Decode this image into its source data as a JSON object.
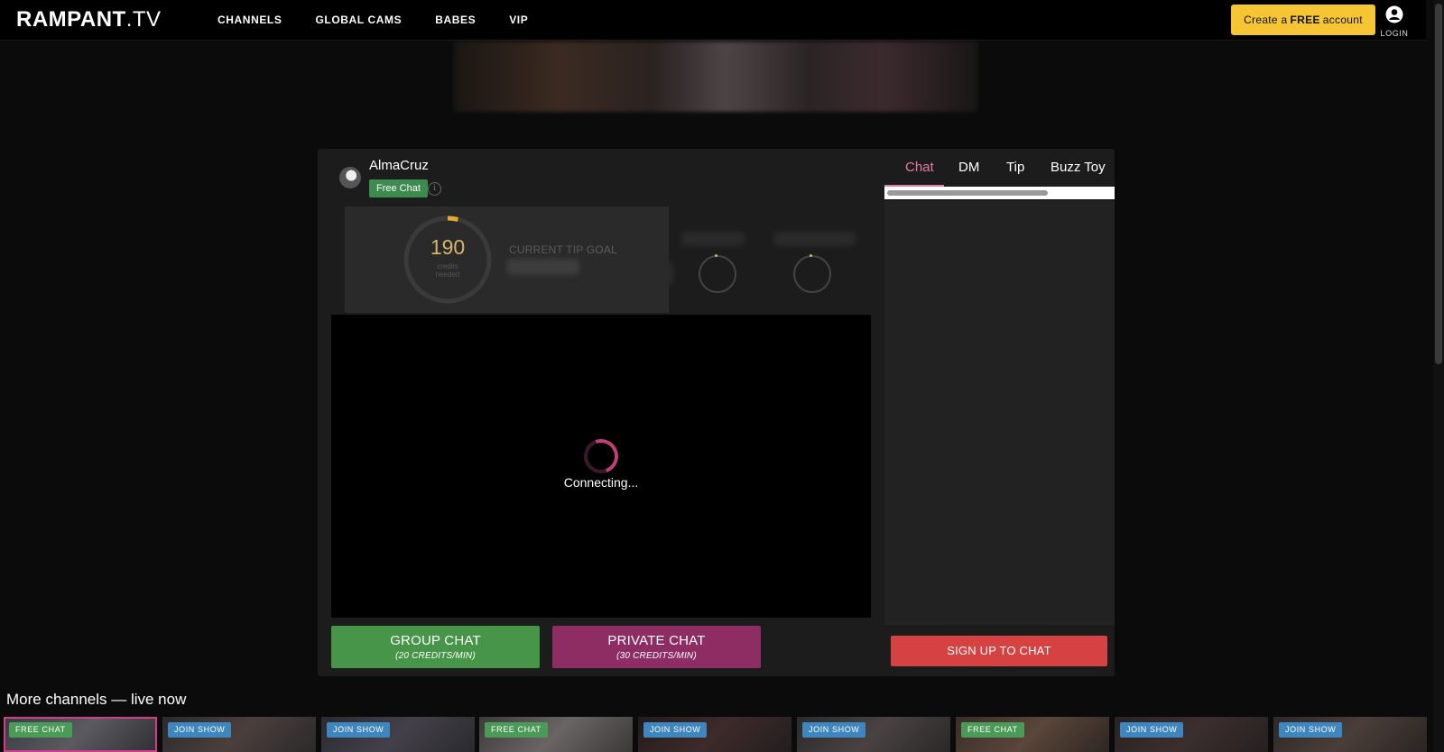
{
  "header": {
    "logo_main": "RAMPANT",
    "logo_tv": ".TV",
    "nav": [
      "CHANNELS",
      "GLOBAL CAMS",
      "BABES",
      "VIP"
    ],
    "cta_prefix": "Create a",
    "cta_bold": "FREE",
    "cta_suffix": "account",
    "login_label": "LOGIN"
  },
  "performer": {
    "name": "AlmaCruz",
    "status_badge": "Free Chat",
    "info_icon": "i"
  },
  "tip_goal": {
    "credits": "190",
    "credits_line1": "credits",
    "credits_line2": "needed",
    "label": "CURRENT TIP GOAL",
    "progress_fraction": 0.04
  },
  "video": {
    "status": "Connecting..."
  },
  "actions": {
    "group_chat_title": "GROUP CHAT",
    "group_chat_price": "(20 CREDITS/MIN)",
    "private_chat_title": "PRIVATE CHAT",
    "private_chat_price": "(30 CREDITS/MIN)"
  },
  "chat": {
    "tabs": [
      "Chat",
      "DM",
      "Tip",
      "Buzz Toy"
    ],
    "active_tab": "Chat",
    "signup_label": "SIGN UP TO CHAT"
  },
  "more_channels": {
    "title": "More channels — live now",
    "items": [
      {
        "badge": "FREE CHAT",
        "type": "free"
      },
      {
        "badge": "JOIN SHOW",
        "type": "join"
      },
      {
        "badge": "JOIN SHOW",
        "type": "join"
      },
      {
        "badge": "FREE CHAT",
        "type": "free"
      },
      {
        "badge": "JOIN SHOW",
        "type": "join"
      },
      {
        "badge": "JOIN SHOW",
        "type": "join"
      },
      {
        "badge": "FREE CHAT",
        "type": "free"
      },
      {
        "badge": "JOIN SHOW",
        "type": "join"
      },
      {
        "badge": "JOIN SHOW",
        "type": "join"
      }
    ]
  },
  "colors": {
    "accent_yellow": "#f5c534",
    "free_green": "#3d8b4e",
    "join_blue": "#3f86be",
    "group_green": "#479549",
    "private_purple": "#8e2d64",
    "signup_red": "#d64241",
    "chat_pink": "#e47ba7"
  }
}
